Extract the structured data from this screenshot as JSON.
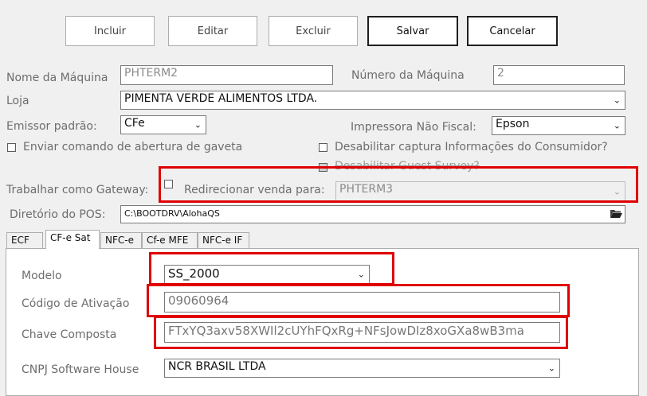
{
  "toolbar": {
    "incluir": "Incluir",
    "editar": "Editar",
    "excluir": "Excluir",
    "salvar": "Salvar",
    "cancelar": "Cancelar"
  },
  "form": {
    "nome_label": "Nome da Máquina",
    "nome_value": "PHTERM2",
    "numero_label": "Número da Máquina",
    "numero_value": "2",
    "loja_label": "Loja",
    "loja_value": "PIMENTA VERDE ALIMENTOS LTDA.",
    "emissor_label": "Emissor padrão:",
    "emissor_value": "CFe",
    "impressora_label": "Impressora Não Fiscal:",
    "impressora_value": "Epson",
    "gaveta_label": "Enviar comando de abertura de gaveta",
    "captura_label": "Desabilitar captura Informações do Consumidor?",
    "guest_label": "Desabilitar Guest Survey?",
    "gateway_label": "Trabalhar como Gateway:",
    "redirecionar_label": "Redirecionar venda para:",
    "redirecionar_value": "PHTERM3",
    "diretorio_label": "Diretório do POS:",
    "diretorio_value": "C:\\BOOTDRV\\AlohaQS"
  },
  "tabs": [
    "ECF",
    "CF-e Sat",
    "NFC-e",
    "Cf-e MFE",
    "NFC-e IF"
  ],
  "sat": {
    "modelo_label": "Modelo",
    "modelo_value": "SS_2000",
    "codigo_label": "Código de Ativação",
    "codigo_value": "09060964",
    "chave_label": "Chave Composta",
    "chave_value": "FTxYQ3axv58XWIl2cUYhFQxRg+NFsJowDIz8xoGXa8wB3ma",
    "cnpj_label": "CNPJ Software House",
    "cnpj_value": "NCR BRASIL LTDA"
  },
  "colors": {
    "highlight": "#e00000",
    "label": "#6d6d6d"
  }
}
